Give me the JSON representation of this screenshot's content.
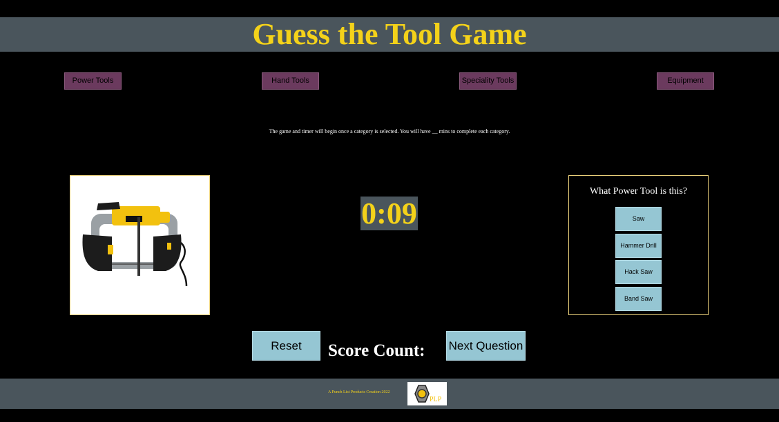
{
  "header": {
    "title": "Guess the Tool Game"
  },
  "categories": [
    {
      "label": "Power Tools"
    },
    {
      "label": "Hand Tools"
    },
    {
      "label": "Speciality Tools"
    },
    {
      "label": "Equipment"
    }
  ],
  "instructions": "The game and timer will begin once a category is selected. You will have __ mins to complete each category.",
  "timer": {
    "value": "0:09"
  },
  "quiz": {
    "question": "What Power Tool is this?",
    "answers": [
      {
        "label": "Saw"
      },
      {
        "label": "Hammer Drill"
      },
      {
        "label": "Hack Saw"
      },
      {
        "label": "Band Saw"
      }
    ],
    "image_icon": "band-saw-image"
  },
  "controls": {
    "reset_label": "Reset",
    "score_label": "Score Count:",
    "next_label": "Next Question"
  },
  "footer": {
    "credit": "A Punch List Products Creation 2022",
    "logo_text": "PLP"
  },
  "colors": {
    "accent_yellow": "#f4d21a",
    "bar_gray": "#4a555c",
    "category_button": "#6b3a5e",
    "answer_button": "#95c6d3",
    "panel_border": "#e9cf7a"
  }
}
